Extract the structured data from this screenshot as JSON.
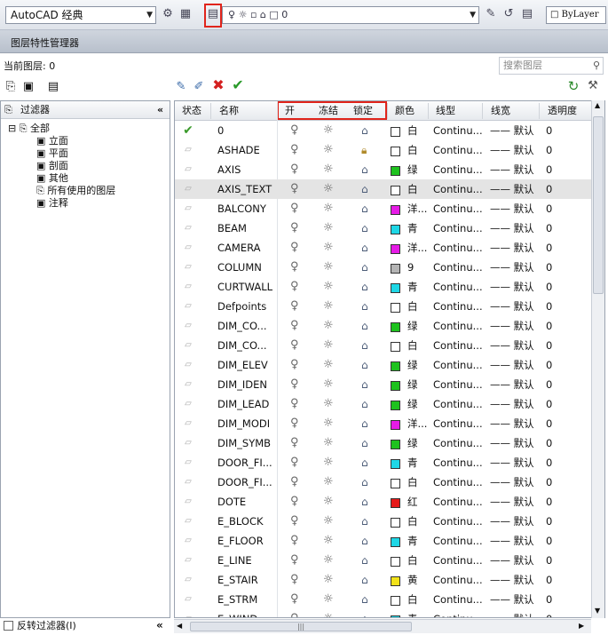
{
  "toolbar": {
    "workspace": "AutoCAD 经典",
    "layer_current": "0",
    "linetype": "ByLayer"
  },
  "title": "图层特性管理器",
  "current_layer": "当前图层: 0",
  "search_placeholder": "搜索图层",
  "filters": {
    "header": "过滤器",
    "items": [
      "全部",
      "立面",
      "平面",
      "剖面",
      "其他",
      "所有使用的图层",
      "注释"
    ]
  },
  "invert_filter": "反转过滤器(I)",
  "columns": [
    "状态",
    "名称",
    "开",
    "冻结",
    "锁定",
    "颜色",
    "线型",
    "线宽",
    "透明度"
  ],
  "layers": [
    {
      "name": "0",
      "color": "白",
      "swatch": "#ffffff",
      "current": true,
      "locked": false
    },
    {
      "name": "ASHADE",
      "color": "白",
      "swatch": "#ffffff",
      "locked": true
    },
    {
      "name": "AXIS",
      "color": "绿",
      "swatch": "#1ec21e",
      "locked": false
    },
    {
      "name": "AXIS_TEXT",
      "color": "白",
      "swatch": "#ffffff",
      "locked": false,
      "selected": true
    },
    {
      "name": "BALCONY",
      "color": "洋...",
      "swatch": "#e61be6",
      "locked": false
    },
    {
      "name": "BEAM",
      "color": "青",
      "swatch": "#1ed7e6",
      "locked": false
    },
    {
      "name": "CAMERA",
      "color": "洋...",
      "swatch": "#e61be6",
      "locked": false
    },
    {
      "name": "COLUMN",
      "color": "9",
      "swatch": "#b4b4b4",
      "locked": false
    },
    {
      "name": "CURTWALL",
      "color": "青",
      "swatch": "#1ed7e6",
      "locked": false
    },
    {
      "name": "Defpoints",
      "color": "白",
      "swatch": "#ffffff",
      "locked": false
    },
    {
      "name": "DIM_CO...",
      "color": "绿",
      "swatch": "#1ec21e",
      "locked": false
    },
    {
      "name": "DIM_CO...",
      "color": "白",
      "swatch": "#ffffff",
      "locked": false
    },
    {
      "name": "DIM_ELEV",
      "color": "绿",
      "swatch": "#1ec21e",
      "locked": false
    },
    {
      "name": "DIM_IDEN",
      "color": "绿",
      "swatch": "#1ec21e",
      "locked": false
    },
    {
      "name": "DIM_LEAD",
      "color": "绿",
      "swatch": "#1ec21e",
      "locked": false
    },
    {
      "name": "DIM_MODI",
      "color": "洋...",
      "swatch": "#e61be6",
      "locked": false
    },
    {
      "name": "DIM_SYMB",
      "color": "绿",
      "swatch": "#1ec21e",
      "locked": false
    },
    {
      "name": "DOOR_FI...",
      "color": "青",
      "swatch": "#1ed7e6",
      "locked": false
    },
    {
      "name": "DOOR_FI...",
      "color": "白",
      "swatch": "#ffffff",
      "locked": false
    },
    {
      "name": "DOTE",
      "color": "红",
      "swatch": "#e61a1a",
      "locked": false
    },
    {
      "name": "E_BLOCK",
      "color": "白",
      "swatch": "#ffffff",
      "locked": false
    },
    {
      "name": "E_FLOOR",
      "color": "青",
      "swatch": "#1ed7e6",
      "locked": false
    },
    {
      "name": "E_LINE",
      "color": "白",
      "swatch": "#ffffff",
      "locked": false
    },
    {
      "name": "E_STAIR",
      "color": "黄",
      "swatch": "#f2e21a",
      "locked": false
    },
    {
      "name": "E_STRM",
      "color": "白",
      "swatch": "#ffffff",
      "locked": false
    },
    {
      "name": "E_WIND...",
      "color": "青",
      "swatch": "#1ed7e6",
      "locked": false
    }
  ],
  "row_defaults": {
    "linetype": "Continu...",
    "lineweight": "—— 默认",
    "transparency": "0"
  }
}
